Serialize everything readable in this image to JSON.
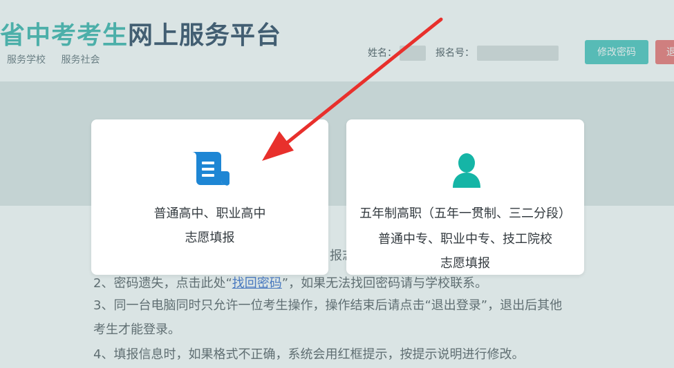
{
  "header": {
    "title_part1": "省中考考生",
    "title_part2": "网上服务平台",
    "subnav": [
      "服务学校",
      "服务社会"
    ],
    "name_label": "姓名：",
    "exam_no_label": "报名号：",
    "change_password": "修改密码",
    "logout": "退"
  },
  "notice": {
    "partial": "报志",
    "l2_prefix": "2、密码遗失，点击此处“",
    "l2_link": "找回密码",
    "l2_suffix": "”，如果无法找回密码请与学校联系。",
    "l3": "3、同一台电脑同时只允许一位考生操作，操作结束后请点击“退出登录”，退出后其他",
    "l4": "考生才能登录。",
    "l5": "4、填报信息时，如果格式不正确，系统会用红框提示，按提示说明进行修改。"
  },
  "cards": [
    {
      "icon": "scroll-document-icon",
      "lines": [
        "普通高中、职业高中",
        "志愿填报"
      ]
    },
    {
      "icon": "person-icon",
      "lines": [
        "五年制高职（五年一贯制、三二分段）",
        "普通中专、职业中专、技工院校",
        "志愿填报"
      ]
    }
  ],
  "colors": {
    "accent": "#3fc3bc",
    "danger": "#ef6a6a",
    "icon_blue": "#1e86d4",
    "arrow_red": "#e8302c"
  }
}
